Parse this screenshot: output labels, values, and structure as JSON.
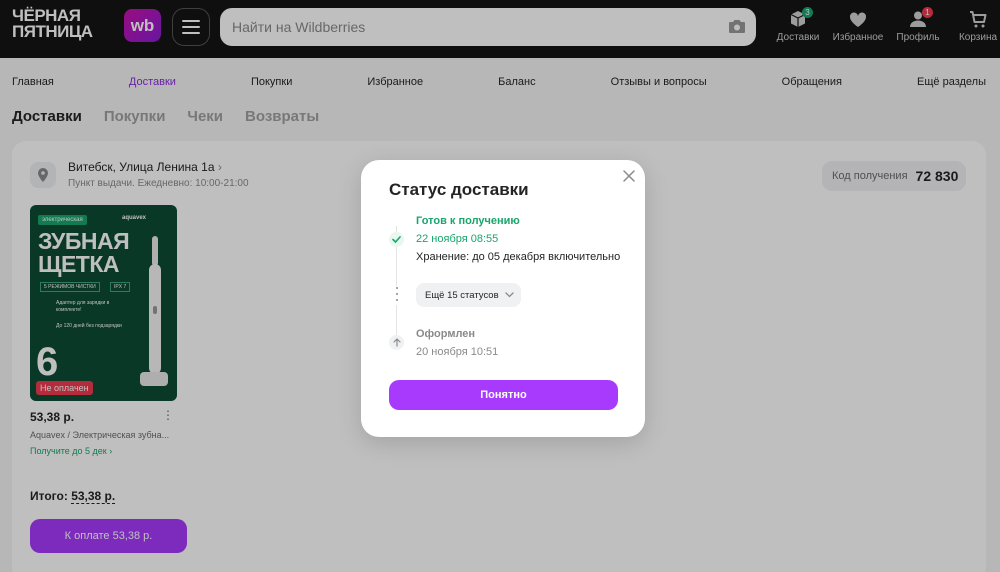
{
  "header": {
    "logo_line1": "Чёрная",
    "logo_line2": "пятница",
    "wb_badge": "wb",
    "search_placeholder": "Найти на Wildberries",
    "icons": [
      {
        "name": "box-icon",
        "label": "Доставки",
        "badge": "3",
        "badge_color": "#19a56c"
      },
      {
        "name": "heart-icon",
        "label": "Избранное",
        "badge": ""
      },
      {
        "name": "user-icon",
        "label": "Профиль",
        "badge": "1",
        "badge_color": "#f03b4f"
      },
      {
        "name": "cart-icon",
        "label": "Корзина",
        "badge": ""
      }
    ]
  },
  "nav": {
    "items": [
      "Главная",
      "Доставки",
      "Покупки",
      "Избранное",
      "Баланс",
      "Отзывы и вопросы",
      "Обращения",
      "Ещё разделы"
    ],
    "active": "Доставки"
  },
  "tabs": {
    "items": [
      "Доставки",
      "Покупки",
      "Чеки",
      "Возвраты"
    ],
    "active": "Доставки"
  },
  "pickup": {
    "address": "Витебск, Улица Ленина 1а",
    "address_sub": "Пункт выдачи. Ежедневно: 10:00-21:00",
    "code_label": "Код получения",
    "code_value": "72 830"
  },
  "product": {
    "img_tag": "электрическая",
    "img_brand": "aquavex",
    "img_title1": "ЗУБНАЯ",
    "img_title2": "ЩЕТКА",
    "img_feature1": "5 РЕЖИМОВ ЧИСТКИ",
    "img_feature2": "IPX 7",
    "img_feature3": "Адаптер для зарядки в комплекте!",
    "img_feature4": "До 120 дней без подзарядки",
    "img_count": "6",
    "status_badge": "Не оплачен",
    "price": "53,38 р.",
    "name": "Aquavex / Электрическая зубна...",
    "delivery": "Получите до 5 дек"
  },
  "order": {
    "total_label": "Итого:",
    "total_value": "53,38 р.",
    "pay_button": "К оплате 53,38 р."
  },
  "modal": {
    "title": "Статус доставки",
    "status1_title": "Готов к получению",
    "status1_date": "22 ноября 08:55",
    "status1_storage": "Хранение: до 05 декабря включительно",
    "more_button": "Ещё 15 статусов",
    "status2_title": "Оформлен",
    "status2_date": "20 ноября 10:51",
    "ok_button": "Понятно"
  },
  "colors": {
    "accent": "#a73afd",
    "success": "#19a56c",
    "header_bg": "#141414",
    "danger": "#f03b4f"
  }
}
